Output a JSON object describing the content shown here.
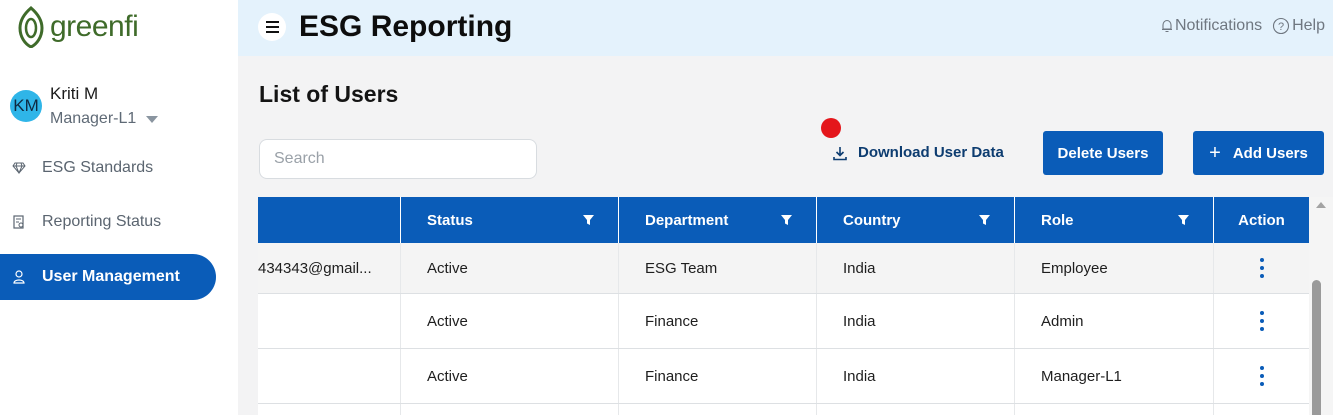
{
  "brand": {
    "name": "greenfi",
    "logo_color": "#3f6b2a",
    "icon": "leaf-logo-icon"
  },
  "user": {
    "initials": "KM",
    "name": "Kriti M",
    "role": "Manager-L1"
  },
  "nav": [
    {
      "label": "ESG Standards",
      "icon": "diamond-icon",
      "active": false
    },
    {
      "label": "Reporting Status",
      "icon": "report-icon",
      "active": false
    },
    {
      "label": "User Management",
      "icon": "user-icon",
      "active": true
    }
  ],
  "header": {
    "title": "ESG Reporting",
    "notifications": "Notifications",
    "help": "Help"
  },
  "page": {
    "title": "List of Users"
  },
  "search": {
    "placeholder": "Search",
    "value": ""
  },
  "actions": {
    "download": "Download User Data",
    "delete": "Delete Users",
    "add": "Add Users"
  },
  "table": {
    "columns": [
      "",
      "Status",
      "Department",
      "Country",
      "Role",
      "Action"
    ],
    "rows": [
      {
        "email": "434343@gmail...",
        "status": "Active",
        "department": "ESG Team",
        "country": "India",
        "role": "Employee"
      },
      {
        "email": "",
        "status": "Active",
        "department": "Finance",
        "country": "India",
        "role": "Admin"
      },
      {
        "email": "",
        "status": "Active",
        "department": "Finance",
        "country": "India",
        "role": "Manager-L1"
      }
    ]
  },
  "colors": {
    "primary": "#0a5cb8",
    "header_bg": "#e4f2fc",
    "alert": "#e4161b"
  }
}
